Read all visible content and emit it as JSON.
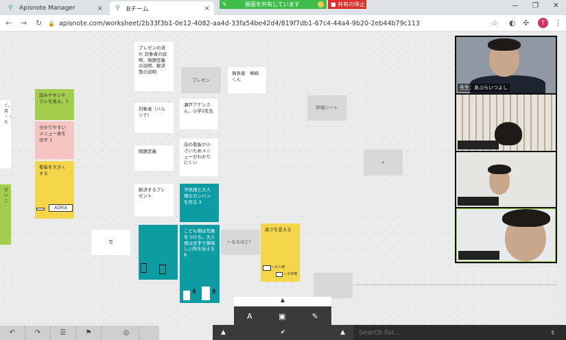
{
  "tabs": [
    {
      "label": "Apisnote Manager",
      "close": "×"
    },
    {
      "label": "Bチーム",
      "close": "×"
    }
  ],
  "share": {
    "banner": "画面を共有しています",
    "stop": "■ 共有の停止"
  },
  "window": {
    "minimize": "—",
    "restore": "❐",
    "close": "✕"
  },
  "nav": {
    "back": "←",
    "forward": "→",
    "reload": "↻"
  },
  "url": "apisnote.com/worksheet/2b33f3b1-0e12-4082-aa4d-33fa54be42d4/819f7db1-67c4-44a4-9b20-2eb44b79c113",
  "profile_initial": "T",
  "cards": {
    "presen_flow": "プレゼンの流れ 対象者の説明、問題定義の説明、解決策の説明",
    "presen": "プレゼン",
    "presenter": "発表者　峰崎くん",
    "target": "対象者（ペルソナ）",
    "seto": "瀬戸アナンさん、小学2年生",
    "eval": "評価シート",
    "problem": "問題定義",
    "problem_desc": "店の看板が小さいためメニューがわかりにくい",
    "plus": "+",
    "solution": "解決するプレゼント",
    "kanban": "子供用と大人用のカンバンを作る 3",
    "readable": "読みやすいチラシを見る。1",
    "menu": "分かりやすいメニュー表を出す 1",
    "big_sign": "看板を大きくする",
    "adria": "ADRIA",
    "photo": "写",
    "naruhodo": "←なるほど！",
    "height": "高さを変える",
    "kids_photo": "こども用は写真をつける。大人用は文字で美味しい所を伝える6",
    "adult_label": "←大人用",
    "kids_label": "←子供用",
    "dot": "·",
    "left_frag1": "く。月 ・・た",
    "left_frag2": "せい ニ"
  },
  "videos": {
    "teacher_label": "先生：あぶらいつよし"
  },
  "toolbar": {
    "undo": "↶",
    "redo": "↷",
    "list": "☰",
    "flag": "⚑",
    "hide": "◎"
  },
  "editor": {
    "collapse": "▲",
    "text": "A",
    "image": "▣",
    "pen": "✎"
  },
  "bottom": {
    "up_left": "▲",
    "check": "✔",
    "up_right": "▲",
    "spin": "⇕"
  },
  "search": {
    "placeholder": "Search for..."
  }
}
